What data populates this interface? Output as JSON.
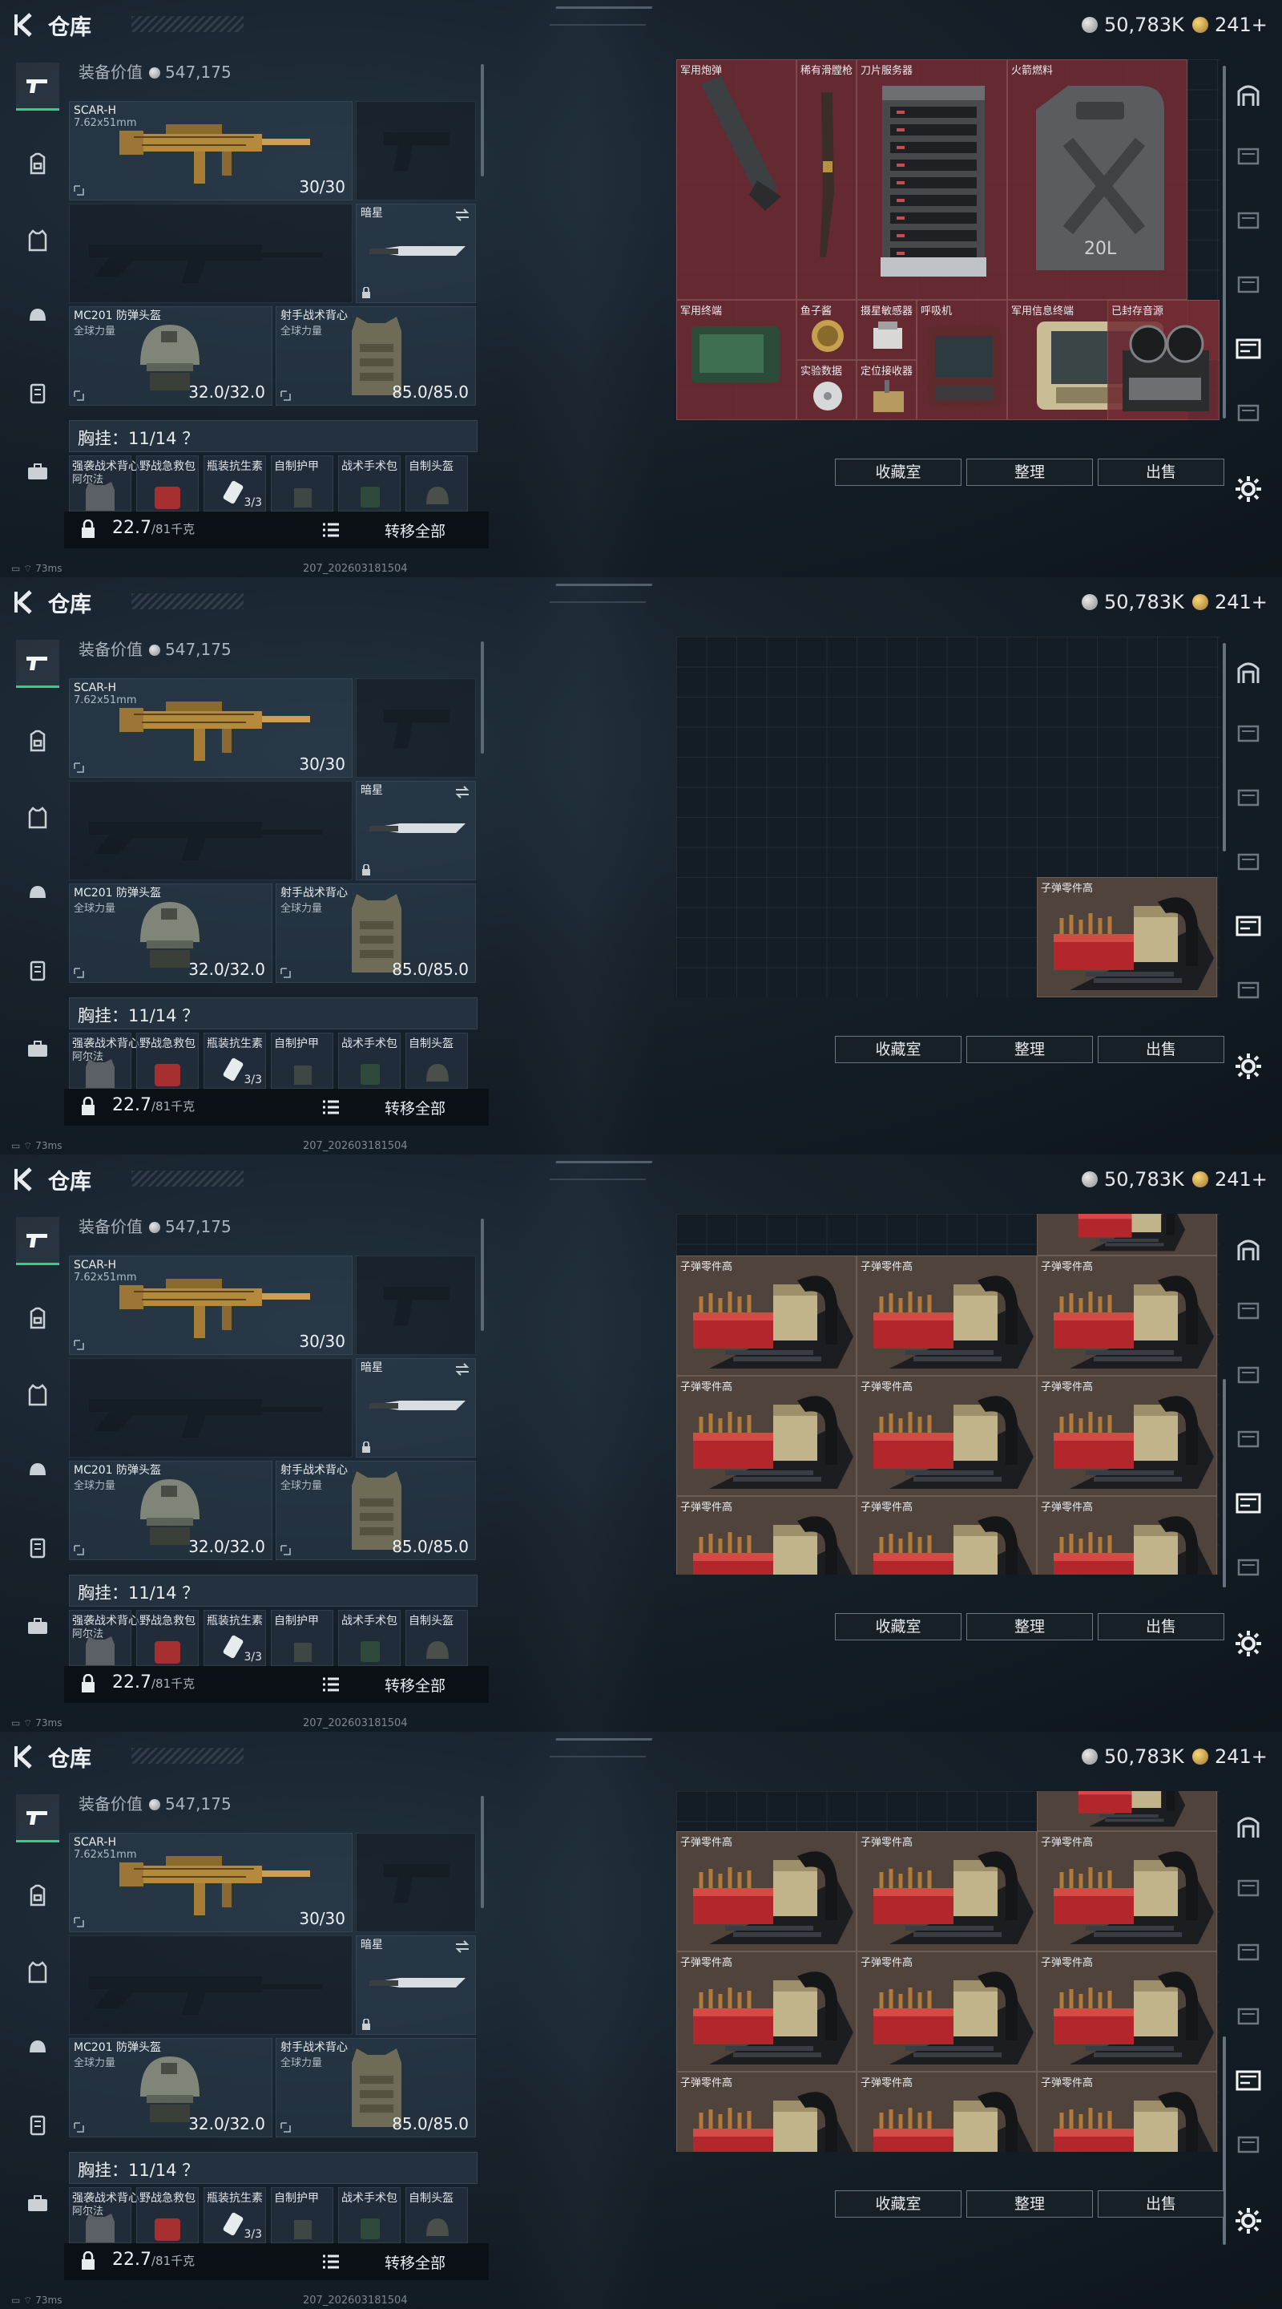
{
  "header": {
    "title": "仓库",
    "coins": "50,783K",
    "gold": "241+"
  },
  "equipment": {
    "value_label": "装备价值",
    "value": "547,175",
    "primary_weapon": {
      "name": "SCAR-H",
      "caliber": "7.62x51mm",
      "ammo": "30/30"
    },
    "melee": {
      "name": "暗星"
    },
    "helmet": {
      "name": "MC201 防弹头盔",
      "sub": "全球力量",
      "durability": "32.0/32.0"
    },
    "armor": {
      "name": "射手战术背心",
      "sub": "全球力量",
      "durability": "85.0/85.0"
    },
    "rig_label": "胸挂：11/14 ？",
    "pouches": [
      {
        "name": "强袭战术背心",
        "sub": "阿尔法",
        "count": ""
      },
      {
        "name": "野战急救包",
        "sub": "",
        "count": ""
      },
      {
        "name": "瓶装抗生素",
        "sub": "",
        "count": "3/3"
      },
      {
        "name": "自制护甲",
        "sub": "",
        "count": ""
      },
      {
        "name": "战术手术包",
        "sub": "",
        "count": ""
      },
      {
        "name": "自制头盔",
        "sub": "",
        "count": ""
      }
    ],
    "weight": "22.7",
    "weight_max": "/81千克",
    "transfer_all": "转移全部"
  },
  "storage_items_frame1": [
    {
      "label": "军用炮弹"
    },
    {
      "label": "稀有滑膛枪"
    },
    {
      "label": "刀片服务器"
    },
    {
      "label": "火箭燃料"
    },
    {
      "label": "军用终端"
    },
    {
      "label": "鱼子酱"
    },
    {
      "label": "摄星敏感器"
    },
    {
      "label": "呼吸机"
    },
    {
      "label": "军用信息终端"
    },
    {
      "label": "已封存音源"
    },
    {
      "label": "实验数据"
    },
    {
      "label": "定位接收器"
    }
  ],
  "ammo_parts_label": "子弹零件高",
  "buttons": {
    "collection": "收藏室",
    "sort": "整理",
    "sell": "出售"
  },
  "status": {
    "ping": "73ms",
    "build": "207_202603181504"
  },
  "icons": {
    "left_nav": [
      "pistol-icon",
      "backpack-icon",
      "armor-icon",
      "helmet-icon",
      "rig-icon",
      "case-icon"
    ],
    "right_nav": [
      "archway-icon",
      "shelf-icon",
      "shelf-icon",
      "shelf-icon",
      "shelf-icon",
      "shelf-icon",
      "selected-shelf-icon",
      "shelf-icon",
      "shelf-icon",
      "settings-icon"
    ]
  },
  "colors": {
    "accent": "#2fd18a",
    "item_red": "#732c34",
    "item_brown": "#4f433c"
  }
}
